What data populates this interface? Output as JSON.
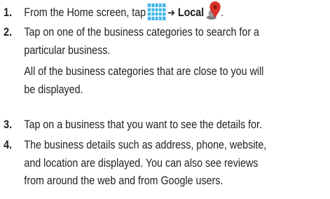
{
  "steps": [
    {
      "number": "1.",
      "text_before": "From the Home screen, tap",
      "arrow": "➔",
      "bold_label": "Local",
      "text_after": ".",
      "icons": [
        "apps-grid-icon",
        "location-pin-person-icon"
      ]
    },
    {
      "number": "2.",
      "lines": [
        "Tap on one of the business categories to search for a",
        "particular business."
      ],
      "note_lines": [
        "All of the business categories that are close to you will",
        "be displayed."
      ]
    },
    {
      "number": "3.",
      "lines": [
        "Tap on a business that you want to see the details for."
      ]
    },
    {
      "number": "4.",
      "lines": [
        "The business details such as address, phone, website,",
        "and location are displayed. You can also see reviews",
        "from around the web and from Google users."
      ]
    }
  ],
  "colors": {
    "text": "#1f1f1f",
    "grid_icon": "#3fb6e8",
    "pin_red": "#d8342b"
  }
}
